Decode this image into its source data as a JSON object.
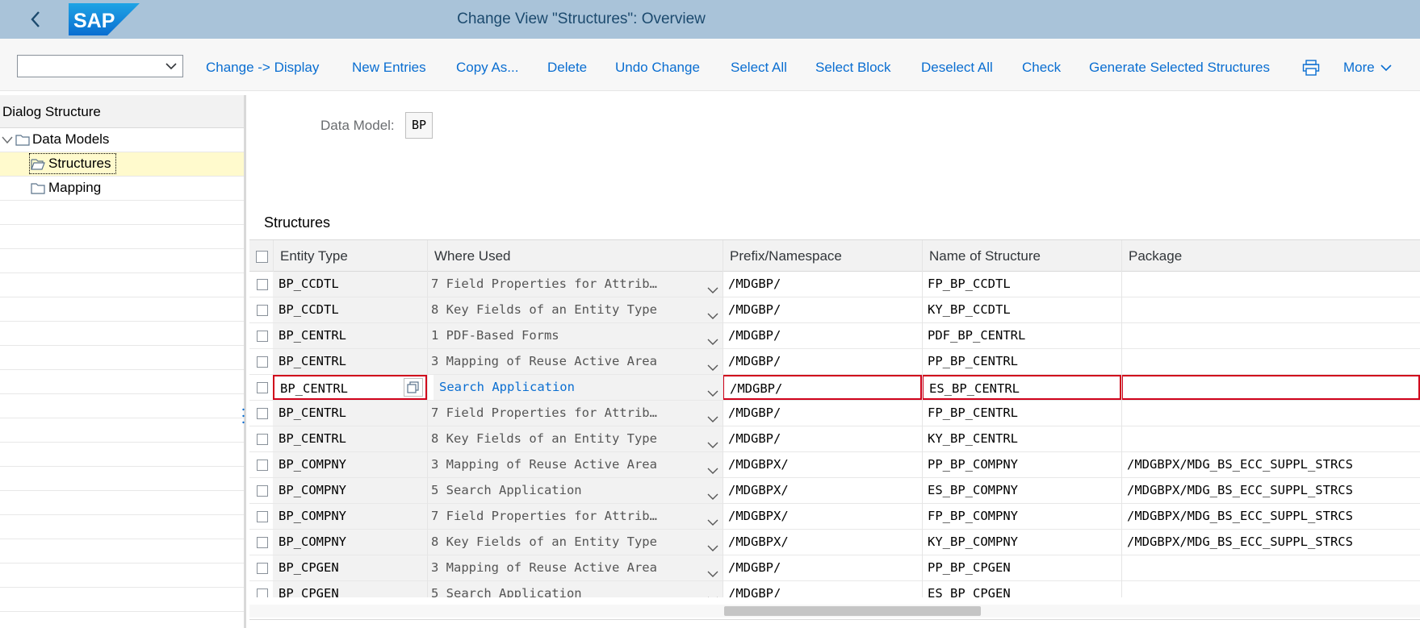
{
  "shell": {
    "title": "Change View \"Structures\": Overview",
    "logo_text": "SAP"
  },
  "toolbar": {
    "select_value": "",
    "buttons": [
      "Change -> Display",
      "New Entries",
      "Copy As...",
      "Delete",
      "Undo Change",
      "Select All",
      "Select Block",
      "Deselect All",
      "Check",
      "Generate Selected Structures"
    ],
    "more_label": "More"
  },
  "dialog_structure": {
    "header": "Dialog Structure",
    "items": [
      {
        "label": "Data Models",
        "level": 0,
        "expanded": true,
        "selected": false
      },
      {
        "label": "Structures",
        "level": 1,
        "selected": true
      },
      {
        "label": "Mapping",
        "level": 1,
        "selected": false
      }
    ]
  },
  "data_model": {
    "label": "Data Model:",
    "value": "BP"
  },
  "structures": {
    "title": "Structures",
    "columns": [
      "Entity Type",
      "Where Used",
      "Prefix/Namespace",
      "Name of Structure",
      "Package"
    ],
    "rows": [
      {
        "entity": "BP_CCDTL",
        "where_used": "7 Field Properties for Attrib…",
        "prefix": "/MDGBP/",
        "name": "FP_BP_CCDTL",
        "package": ""
      },
      {
        "entity": "BP_CCDTL",
        "where_used": "8 Key Fields of an Entity Type",
        "prefix": "/MDGBP/",
        "name": "KY_BP_CCDTL",
        "package": ""
      },
      {
        "entity": "BP_CENTRL",
        "where_used": "1 PDF-Based Forms",
        "prefix": "/MDGBP/",
        "name": "PDF_BP_CENTRL",
        "package": ""
      },
      {
        "entity": "BP_CENTRL",
        "where_used": "3 Mapping of Reuse Active Area",
        "prefix": "/MDGBP/",
        "name": "PP_BP_CENTRL",
        "package": ""
      },
      {
        "entity": "BP_CENTRL",
        "where_used": "Search Application",
        "prefix": "/MDGBP/",
        "name": "ES_BP_CENTRL",
        "package": "",
        "current": true
      },
      {
        "entity": "BP_CENTRL",
        "where_used": "7 Field Properties for Attrib…",
        "prefix": "/MDGBP/",
        "name": "FP_BP_CENTRL",
        "package": ""
      },
      {
        "entity": "BP_CENTRL",
        "where_used": "8 Key Fields of an Entity Type",
        "prefix": "/MDGBP/",
        "name": "KY_BP_CENTRL",
        "package": ""
      },
      {
        "entity": "BP_COMPNY",
        "where_used": "3 Mapping of Reuse Active Area",
        "prefix": "/MDGBPX/",
        "name": "PP_BP_COMPNY",
        "package": "/MDGBPX/MDG_BS_ECC_SUPPL_STRCS"
      },
      {
        "entity": "BP_COMPNY",
        "where_used": "5 Search Application",
        "prefix": "/MDGBPX/",
        "name": "ES_BP_COMPNY",
        "package": "/MDGBPX/MDG_BS_ECC_SUPPL_STRCS"
      },
      {
        "entity": "BP_COMPNY",
        "where_used": "7 Field Properties for Attrib…",
        "prefix": "/MDGBPX/",
        "name": "FP_BP_COMPNY",
        "package": "/MDGBPX/MDG_BS_ECC_SUPPL_STRCS"
      },
      {
        "entity": "BP_COMPNY",
        "where_used": "8 Key Fields of an Entity Type",
        "prefix": "/MDGBPX/",
        "name": "KY_BP_COMPNY",
        "package": "/MDGBPX/MDG_BS_ECC_SUPPL_STRCS"
      },
      {
        "entity": "BP_CPGEN",
        "where_used": "3 Mapping of Reuse Active Area",
        "prefix": "/MDGBP/",
        "name": "PP_BP_CPGEN",
        "package": ""
      },
      {
        "entity": "BP_CPGEN",
        "where_used": "5 Search Application",
        "prefix": "/MDGBP/",
        "name": "ES_BP_CPGEN",
        "package": ""
      }
    ]
  }
}
